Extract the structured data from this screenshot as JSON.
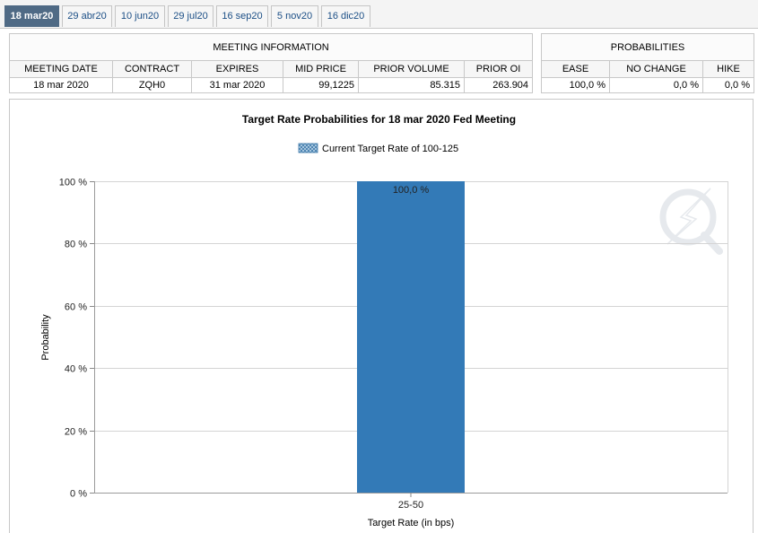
{
  "tabs": [
    {
      "label": "18 mar20",
      "active": true
    },
    {
      "label": "29 abr20",
      "active": false
    },
    {
      "label": "10 jun20",
      "active": false
    },
    {
      "label": "29 jul20",
      "active": false
    },
    {
      "label": "16 sep20",
      "active": false
    },
    {
      "label": "5 nov20",
      "active": false
    },
    {
      "label": "16 dic20",
      "active": false
    }
  ],
  "meeting_info": {
    "section_label": "Meeting Information",
    "headers": [
      "Meeting Date",
      "Contract",
      "Expires",
      "Mid Price",
      "Prior Volume",
      "Prior OI"
    ],
    "row": [
      "18 mar 2020",
      "ZQH0",
      "31 mar 2020",
      "99,1225",
      "85.315",
      "263.904"
    ]
  },
  "probabilities": {
    "section_label": "Probabilities",
    "headers": [
      "Ease",
      "No Change",
      "Hike"
    ],
    "row": [
      "100,0 %",
      "0,0 %",
      "0,0 %"
    ]
  },
  "chart_data": {
    "type": "bar",
    "title": "Target Rate Probabilities for 18 mar 2020 Fed Meeting",
    "legend": [
      {
        "name": "Current Target Rate of 100-125",
        "position": "top-center"
      }
    ],
    "categories": [
      "25-50"
    ],
    "values": [
      100.0
    ],
    "data_labels": [
      "100,0 %"
    ],
    "xlabel": "Target Rate (in bps)",
    "ylabel": "Probability",
    "ylim": [
      0,
      100
    ],
    "yticks": [
      0,
      20,
      40,
      60,
      80,
      100
    ],
    "ytick_labels": [
      "0 %",
      "20 %",
      "40 %",
      "60 %",
      "80 %",
      "100 %"
    ],
    "grid": true,
    "bar_color": "#337ab7"
  }
}
